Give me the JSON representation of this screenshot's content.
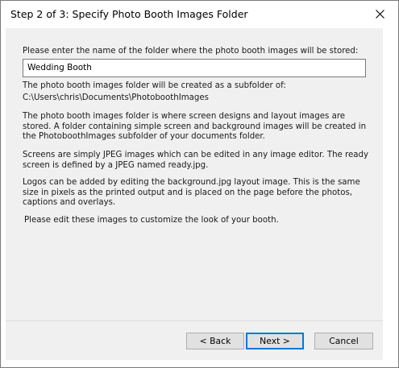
{
  "window": {
    "title": "Step 2 of 3: Specify Photo Booth Images Folder"
  },
  "form": {
    "prompt": "Please enter the name of the folder where the photo booth images will be stored:",
    "folder_name_value": "Wedding Booth"
  },
  "info": {
    "subfolder_note": "The photo booth images folder will be created as a subfolder of:",
    "subfolder_path": "C:\\Users\\chris\\Documents\\PhotoboothImages",
    "paragraph_designs": "The photo booth images folder is where screen designs and layout images are stored. A folder containing simple screen and background images will be created in the PhotoboothImages subfolder of your documents folder.",
    "paragraph_screens": "Screens are simply JPEG images which can be edited in any image editor. The ready screen is defined by a JPEG named ready.jpg.",
    "paragraph_logos": "Logos can be added by editing the background.jpg layout image. This is the same size in pixels as the printed output and is placed on the page before the photos, captions and overlays.",
    "paragraph_customize": "Please edit these images to customize the look of your booth."
  },
  "buttons": {
    "back_label": "< Back",
    "next_label": "Next >",
    "cancel_label": "Cancel"
  },
  "icons": {
    "close": "close-icon"
  },
  "colors": {
    "panel_background": "#f0f0f0",
    "default_button_border": "#0078d7"
  }
}
